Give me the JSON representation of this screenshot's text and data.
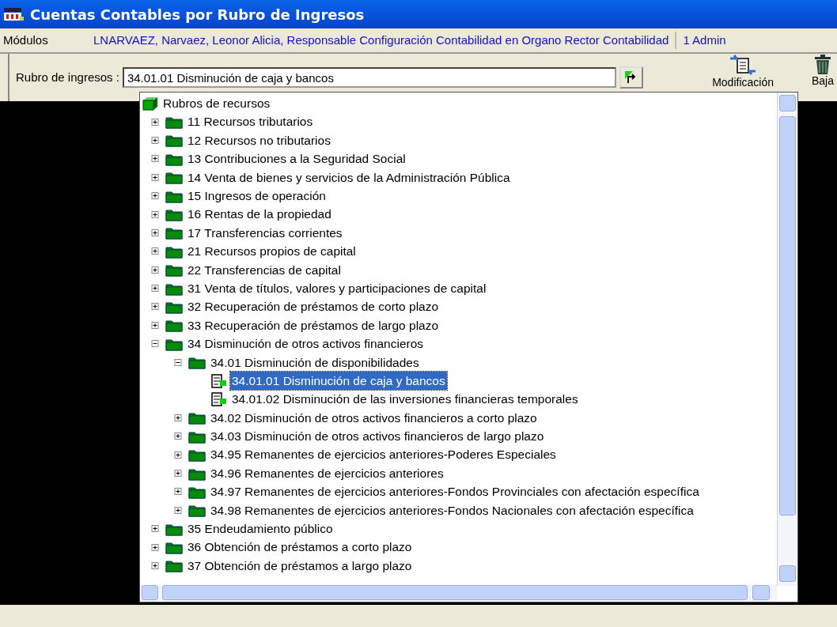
{
  "window": {
    "title": "Cuentas Contables por Rubro de Ingresos"
  },
  "menu_bar": {
    "menu": "Módulos",
    "user": "LNARVAEZ, Narvaez, Leonor Alicia, Responsable Configuración Contabilidad en Organo Rector Contabilidad",
    "role": "1 Admin"
  },
  "toolbar": {
    "label": "Rubro de ingresos :",
    "value": "34.01.01 Disminución de caja y bancos",
    "buttons": [
      {
        "kind": "modify",
        "label": "Modificación"
      },
      {
        "kind": "delete",
        "label": "Baja"
      }
    ]
  },
  "tree": {
    "items": [
      {
        "kind": "root",
        "label": "Rubros de recursos",
        "selected": false,
        "children": [
          {
            "kind": "folder",
            "label": "11 Recursos tributarios",
            "selected": false,
            "expanded": false
          },
          {
            "kind": "folder",
            "label": "12 Recursos no tributarios",
            "selected": false,
            "expanded": false
          },
          {
            "kind": "folder",
            "label": "13 Contribuciones a la Seguridad Social",
            "selected": false,
            "expanded": false
          },
          {
            "kind": "folder",
            "label": "14 Venta de bienes y servicios de la Administración Pública",
            "selected": false,
            "expanded": false
          },
          {
            "kind": "folder",
            "label": "15 Ingresos de operación",
            "selected": false,
            "expanded": false
          },
          {
            "kind": "folder",
            "label": "16 Rentas de la propiedad",
            "selected": false,
            "expanded": false
          },
          {
            "kind": "folder",
            "label": "17 Transferencias corrientes",
            "selected": false,
            "expanded": false
          },
          {
            "kind": "folder",
            "label": "21 Recursos propios de capital",
            "selected": false,
            "expanded": false
          },
          {
            "kind": "folder",
            "label": "22 Transferencias de capital",
            "selected": false,
            "expanded": false
          },
          {
            "kind": "folder",
            "label": "31 Venta de títulos, valores  y participaciones de capital",
            "selected": false,
            "expanded": false
          },
          {
            "kind": "folder",
            "label": "32 Recuperación de préstamos de corto plazo",
            "selected": false,
            "expanded": false
          },
          {
            "kind": "folder",
            "label": "33 Recuperación de préstamos de largo plazo",
            "selected": false,
            "expanded": false
          },
          {
            "kind": "folder",
            "label": "34 Disminución de otros activos financieros",
            "selected": false,
            "expanded": true,
            "children": [
              {
                "kind": "folder",
                "label": "34.01 Disminución de disponibilidades",
                "selected": false,
                "expanded": true,
                "children": [
                  {
                    "kind": "leaf",
                    "label": "34.01.01 Disminución de caja y bancos",
                    "selected": true
                  },
                  {
                    "kind": "leaf",
                    "label": "34.01.02 Disminución de las inversiones financieras temporales",
                    "selected": false
                  }
                ]
              },
              {
                "kind": "folder",
                "label": "34.02 Disminución de otros activos financieros a corto plazo",
                "selected": false,
                "expanded": false
              },
              {
                "kind": "folder",
                "label": "34.03 Disminución de otros activos financieros de largo plazo",
                "selected": false,
                "expanded": false
              },
              {
                "kind": "folder",
                "label": "34.95 Remanentes de ejercicios anteriores-Poderes Especiales",
                "selected": false,
                "expanded": false
              },
              {
                "kind": "folder",
                "label": "34.96 Remanentes de ejercicios anteriores",
                "selected": false,
                "expanded": false
              },
              {
                "kind": "folder",
                "label": "34.97 Remanentes de ejercicios anteriores-Fondos Provinciales con afectación específica",
                "selected": false,
                "expanded": false
              },
              {
                "kind": "folder",
                "label": "34.98 Remanentes de ejercicios anteriores-Fondos Nacionales con afectación específica",
                "selected": false,
                "expanded": false
              }
            ]
          },
          {
            "kind": "folder",
            "label": "35 Endeudamiento público",
            "selected": false,
            "expanded": false
          },
          {
            "kind": "folder",
            "label": "36 Obtención de préstamos a corto plazo",
            "selected": false,
            "expanded": false
          },
          {
            "kind": "folder",
            "label": "37 Obtención de préstamos a largo plazo",
            "selected": false,
            "expanded": false
          }
        ]
      }
    ]
  }
}
